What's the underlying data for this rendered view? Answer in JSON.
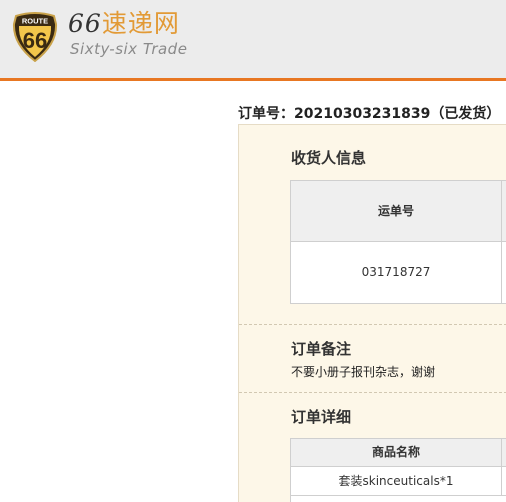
{
  "header": {
    "logo_top_text": "ROUTE",
    "logo_number": "66",
    "brand_number": "66",
    "brand_cn": "速递网",
    "brand_en": "Sixty-six Trade"
  },
  "order": {
    "title": "订单号：20210303231839（已发货）"
  },
  "consignee": {
    "title": "收货人信息",
    "column_header": "运单号",
    "tracking_number": "031718727"
  },
  "remarks": {
    "title": "订单备注",
    "text": "不要小册子报刊杂志，谢谢"
  },
  "details": {
    "title": "订单详细",
    "column_header": "商品名称",
    "items": [
      "套装skinceuticals*1"
    ]
  },
  "colors": {
    "accent": "#e87722",
    "brand_cn": "#e29a36",
    "panel_bg": "#fdf7e8",
    "header_bg": "#ececec"
  }
}
